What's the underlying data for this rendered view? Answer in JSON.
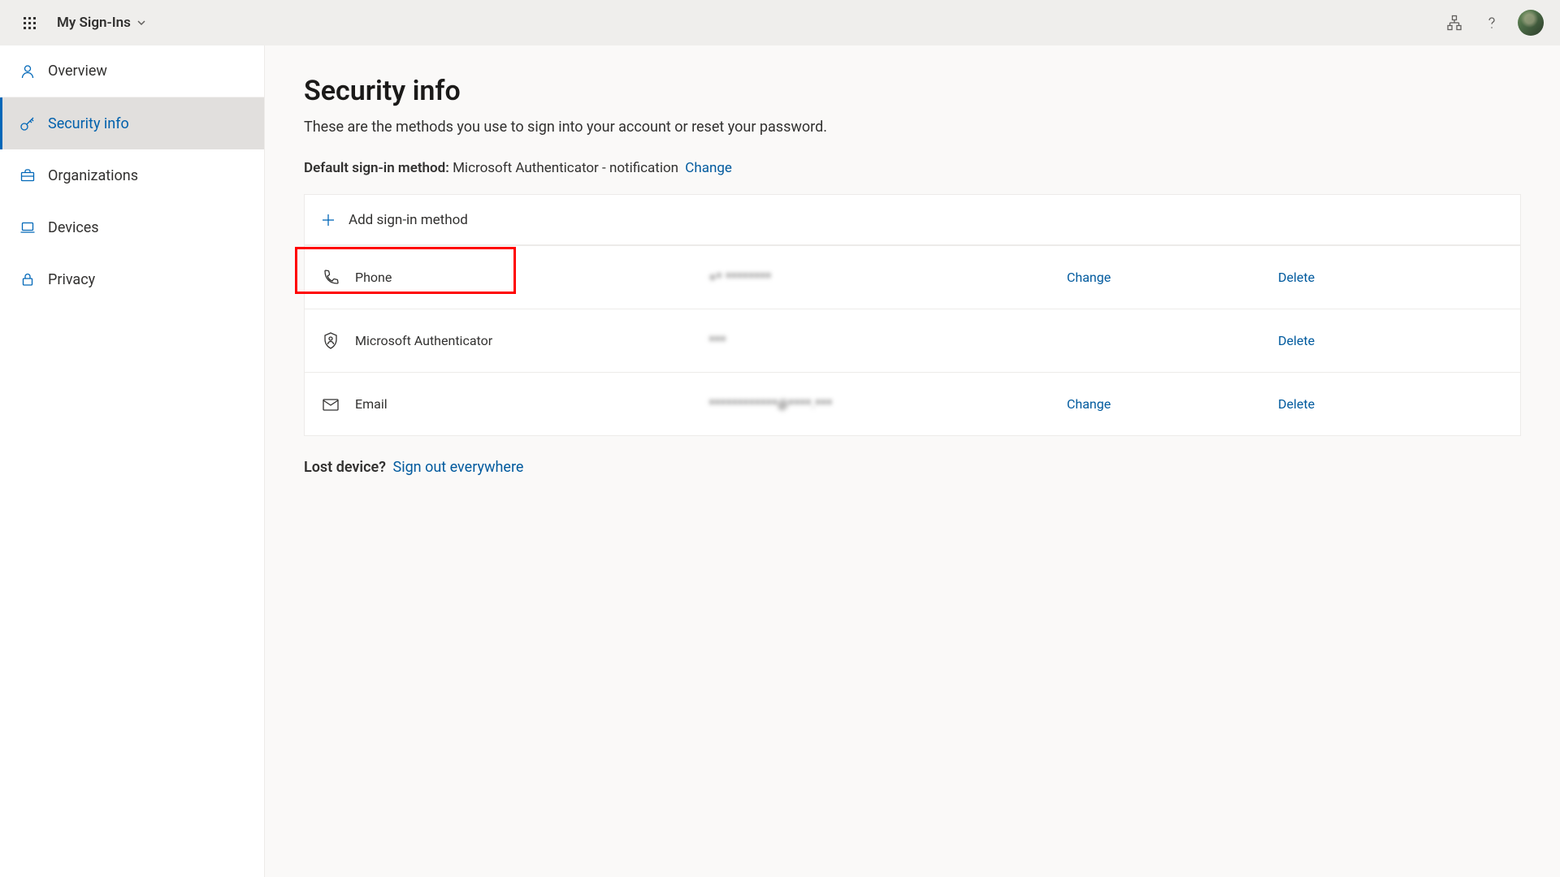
{
  "topbar": {
    "app_title": "My Sign-Ins"
  },
  "sidebar": {
    "items": [
      {
        "label": "Overview"
      },
      {
        "label": "Security info"
      },
      {
        "label": "Organizations"
      },
      {
        "label": "Devices"
      },
      {
        "label": "Privacy"
      }
    ]
  },
  "page": {
    "title": "Security info",
    "description": "These are the methods you use to sign into your account or reset your password.",
    "default_label": "Default sign-in method:",
    "default_value": "Microsoft Authenticator - notification",
    "change_link": "Change",
    "add_label": "Add sign-in method",
    "lost_label": "Lost device?",
    "signout_link": "Sign out everywhere"
  },
  "methods": [
    {
      "name": "Phone",
      "value": "+* ********",
      "change": "Change",
      "delete": "Delete"
    },
    {
      "name": "Microsoft Authenticator",
      "value": "***",
      "change": "",
      "delete": "Delete"
    },
    {
      "name": "Email",
      "value": "************@****.***",
      "change": "Change",
      "delete": "Delete"
    }
  ]
}
